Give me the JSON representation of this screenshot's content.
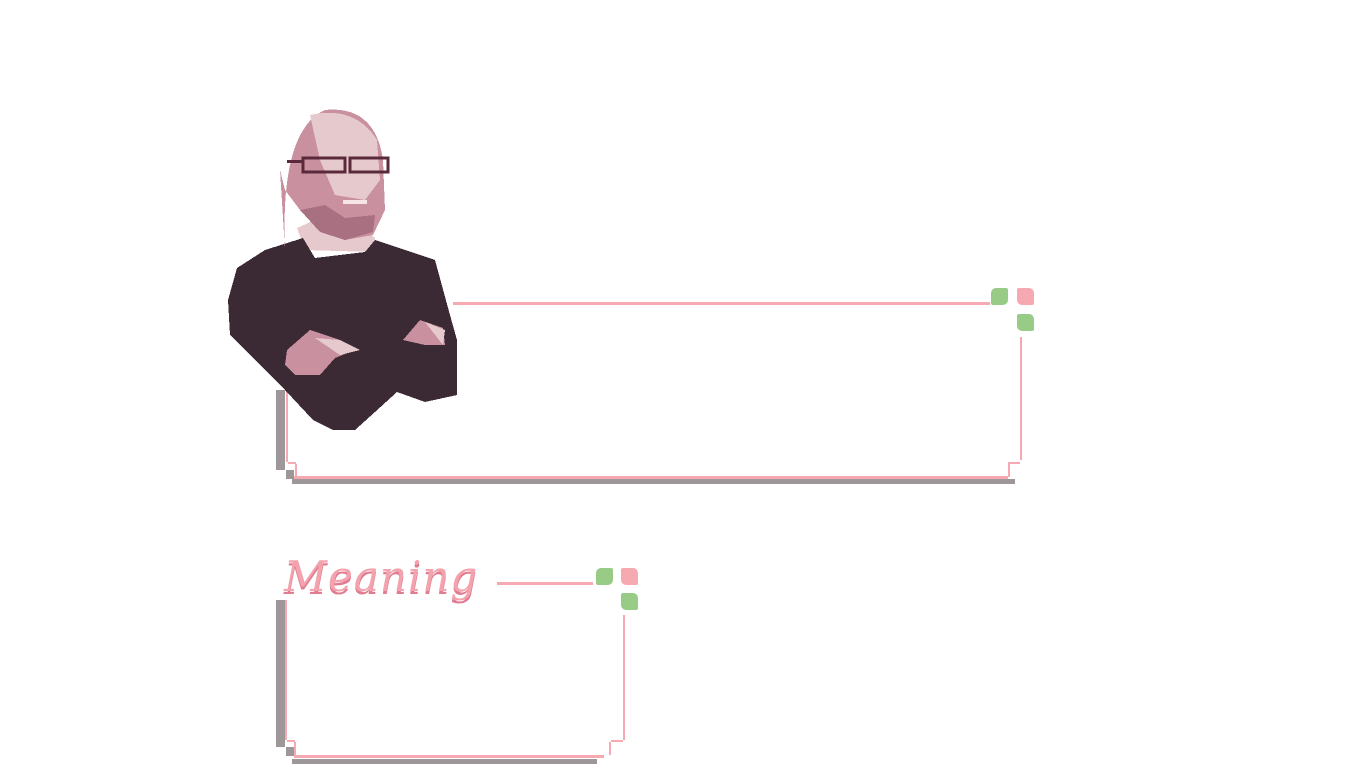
{
  "speaker_panel": {
    "portrait": "bald-man-with-glasses-arms-crossed",
    "dialog_text": ""
  },
  "meaning_panel": {
    "title": "Meaning",
    "body_text": ""
  },
  "colors": {
    "border": "#f7a9b1",
    "shadow": "#9d9799",
    "title": "#f2a3ad",
    "title_shade": "#e07b91",
    "clover_green": "#97cb86",
    "clover_pink": "#f7a9b1",
    "portrait_sweater": "#3b2a33"
  },
  "icons": [
    "clover-icon"
  ]
}
